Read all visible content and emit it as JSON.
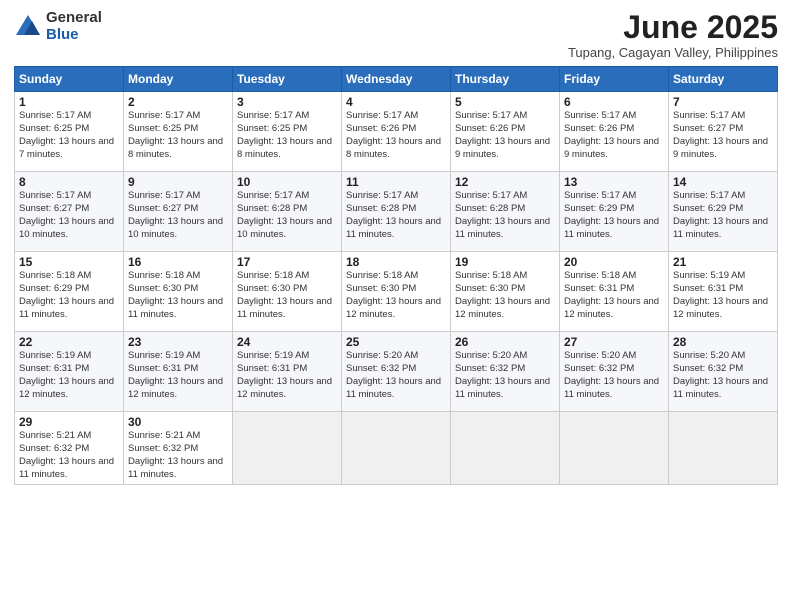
{
  "logo": {
    "general": "General",
    "blue": "Blue"
  },
  "title": "June 2025",
  "location": "Tupang, Cagayan Valley, Philippines",
  "weekdays": [
    "Sunday",
    "Monday",
    "Tuesday",
    "Wednesday",
    "Thursday",
    "Friday",
    "Saturday"
  ],
  "weeks": [
    [
      {
        "day": 1,
        "sunrise": "5:17 AM",
        "sunset": "6:25 PM",
        "daylight": "13 hours and 7 minutes."
      },
      {
        "day": 2,
        "sunrise": "5:17 AM",
        "sunset": "6:25 PM",
        "daylight": "13 hours and 8 minutes."
      },
      {
        "day": 3,
        "sunrise": "5:17 AM",
        "sunset": "6:25 PM",
        "daylight": "13 hours and 8 minutes."
      },
      {
        "day": 4,
        "sunrise": "5:17 AM",
        "sunset": "6:26 PM",
        "daylight": "13 hours and 8 minutes."
      },
      {
        "day": 5,
        "sunrise": "5:17 AM",
        "sunset": "6:26 PM",
        "daylight": "13 hours and 9 minutes."
      },
      {
        "day": 6,
        "sunrise": "5:17 AM",
        "sunset": "6:26 PM",
        "daylight": "13 hours and 9 minutes."
      },
      {
        "day": 7,
        "sunrise": "5:17 AM",
        "sunset": "6:27 PM",
        "daylight": "13 hours and 9 minutes."
      }
    ],
    [
      {
        "day": 8,
        "sunrise": "5:17 AM",
        "sunset": "6:27 PM",
        "daylight": "13 hours and 10 minutes."
      },
      {
        "day": 9,
        "sunrise": "5:17 AM",
        "sunset": "6:27 PM",
        "daylight": "13 hours and 10 minutes."
      },
      {
        "day": 10,
        "sunrise": "5:17 AM",
        "sunset": "6:28 PM",
        "daylight": "13 hours and 10 minutes."
      },
      {
        "day": 11,
        "sunrise": "5:17 AM",
        "sunset": "6:28 PM",
        "daylight": "13 hours and 11 minutes."
      },
      {
        "day": 12,
        "sunrise": "5:17 AM",
        "sunset": "6:28 PM",
        "daylight": "13 hours and 11 minutes."
      },
      {
        "day": 13,
        "sunrise": "5:17 AM",
        "sunset": "6:29 PM",
        "daylight": "13 hours and 11 minutes."
      },
      {
        "day": 14,
        "sunrise": "5:17 AM",
        "sunset": "6:29 PM",
        "daylight": "13 hours and 11 minutes."
      }
    ],
    [
      {
        "day": 15,
        "sunrise": "5:18 AM",
        "sunset": "6:29 PM",
        "daylight": "13 hours and 11 minutes."
      },
      {
        "day": 16,
        "sunrise": "5:18 AM",
        "sunset": "6:30 PM",
        "daylight": "13 hours and 11 minutes."
      },
      {
        "day": 17,
        "sunrise": "5:18 AM",
        "sunset": "6:30 PM",
        "daylight": "13 hours and 11 minutes."
      },
      {
        "day": 18,
        "sunrise": "5:18 AM",
        "sunset": "6:30 PM",
        "daylight": "13 hours and 12 minutes."
      },
      {
        "day": 19,
        "sunrise": "5:18 AM",
        "sunset": "6:30 PM",
        "daylight": "13 hours and 12 minutes."
      },
      {
        "day": 20,
        "sunrise": "5:18 AM",
        "sunset": "6:31 PM",
        "daylight": "13 hours and 12 minutes."
      },
      {
        "day": 21,
        "sunrise": "5:19 AM",
        "sunset": "6:31 PM",
        "daylight": "13 hours and 12 minutes."
      }
    ],
    [
      {
        "day": 22,
        "sunrise": "5:19 AM",
        "sunset": "6:31 PM",
        "daylight": "13 hours and 12 minutes."
      },
      {
        "day": 23,
        "sunrise": "5:19 AM",
        "sunset": "6:31 PM",
        "daylight": "13 hours and 12 minutes."
      },
      {
        "day": 24,
        "sunrise": "5:19 AM",
        "sunset": "6:31 PM",
        "daylight": "13 hours and 12 minutes."
      },
      {
        "day": 25,
        "sunrise": "5:20 AM",
        "sunset": "6:32 PM",
        "daylight": "13 hours and 11 minutes."
      },
      {
        "day": 26,
        "sunrise": "5:20 AM",
        "sunset": "6:32 PM",
        "daylight": "13 hours and 11 minutes."
      },
      {
        "day": 27,
        "sunrise": "5:20 AM",
        "sunset": "6:32 PM",
        "daylight": "13 hours and 11 minutes."
      },
      {
        "day": 28,
        "sunrise": "5:20 AM",
        "sunset": "6:32 PM",
        "daylight": "13 hours and 11 minutes."
      }
    ],
    [
      {
        "day": 29,
        "sunrise": "5:21 AM",
        "sunset": "6:32 PM",
        "daylight": "13 hours and 11 minutes."
      },
      {
        "day": 30,
        "sunrise": "5:21 AM",
        "sunset": "6:32 PM",
        "daylight": "13 hours and 11 minutes."
      },
      null,
      null,
      null,
      null,
      null
    ]
  ]
}
